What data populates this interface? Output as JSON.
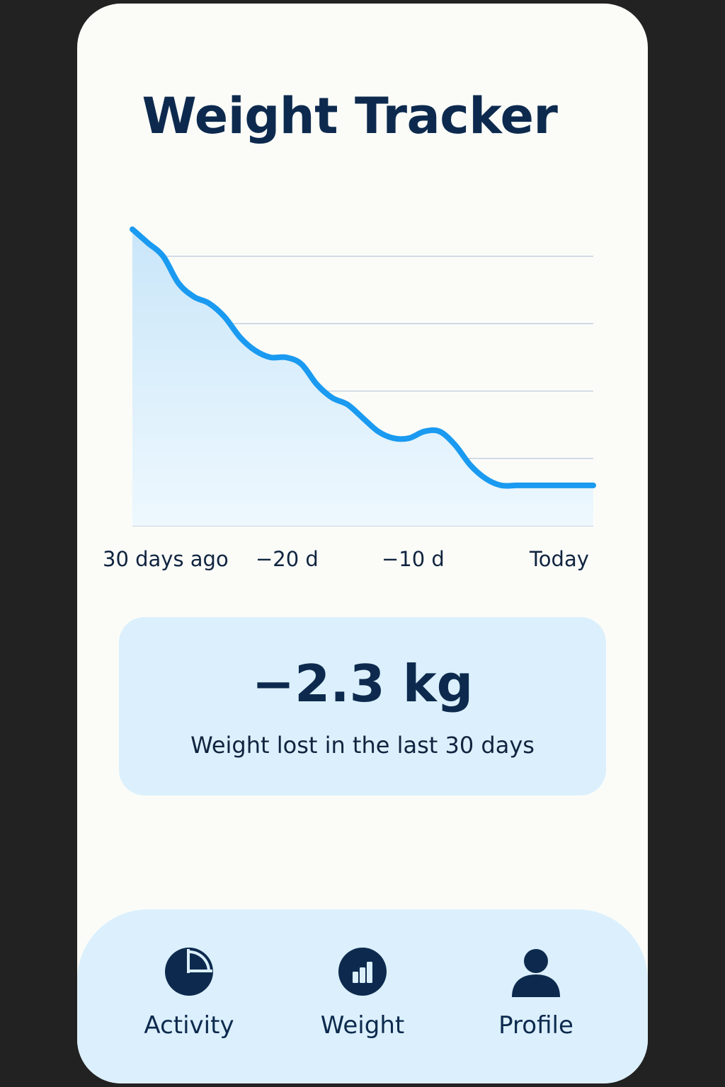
{
  "app": {
    "title": "Weight Tracker"
  },
  "colors": {
    "accent": "#1a9af0",
    "dark": "#0d2a4e",
    "card": "#dbf0fc",
    "background": "#fbfcf8"
  },
  "chart_data": {
    "type": "area",
    "title": "",
    "xlabel": "",
    "ylabel": "",
    "x_tick_labels": [
      "30 days ago",
      "−20 d",
      "−10 d",
      "Today"
    ],
    "x_ticks": [
      -30,
      -20,
      -10,
      0
    ],
    "grid": true,
    "series": [
      {
        "x": [
          -30,
          -29,
          -28,
          -27,
          -26,
          -25,
          -24,
          -23,
          -22,
          -21,
          -20,
          -19,
          -18,
          -17,
          -16,
          -15,
          -14,
          -13,
          -12,
          -11,
          -10,
          -9,
          -8,
          -7,
          -6,
          -5,
          -4,
          -3,
          -2,
          -1,
          0
        ],
        "values": [
          4.4,
          4.2,
          4.0,
          3.6,
          3.4,
          3.3,
          3.1,
          2.8,
          2.6,
          2.5,
          2.5,
          2.4,
          2.1,
          1.9,
          1.8,
          1.6,
          1.4,
          1.3,
          1.3,
          1.4,
          1.4,
          1.2,
          0.9,
          0.7,
          0.6,
          0.6,
          0.6,
          0.6,
          0.6,
          0.6,
          0.6
        ]
      }
    ]
  },
  "summary": {
    "value": "−2.3 kg",
    "caption": "Weight lost in the last 30 days"
  },
  "nav": {
    "items": [
      {
        "label": "Activity",
        "icon": "pie-chart-icon"
      },
      {
        "label": "Weight",
        "icon": "bar-chart-icon"
      },
      {
        "label": "Profile",
        "icon": "user-icon"
      }
    ]
  }
}
